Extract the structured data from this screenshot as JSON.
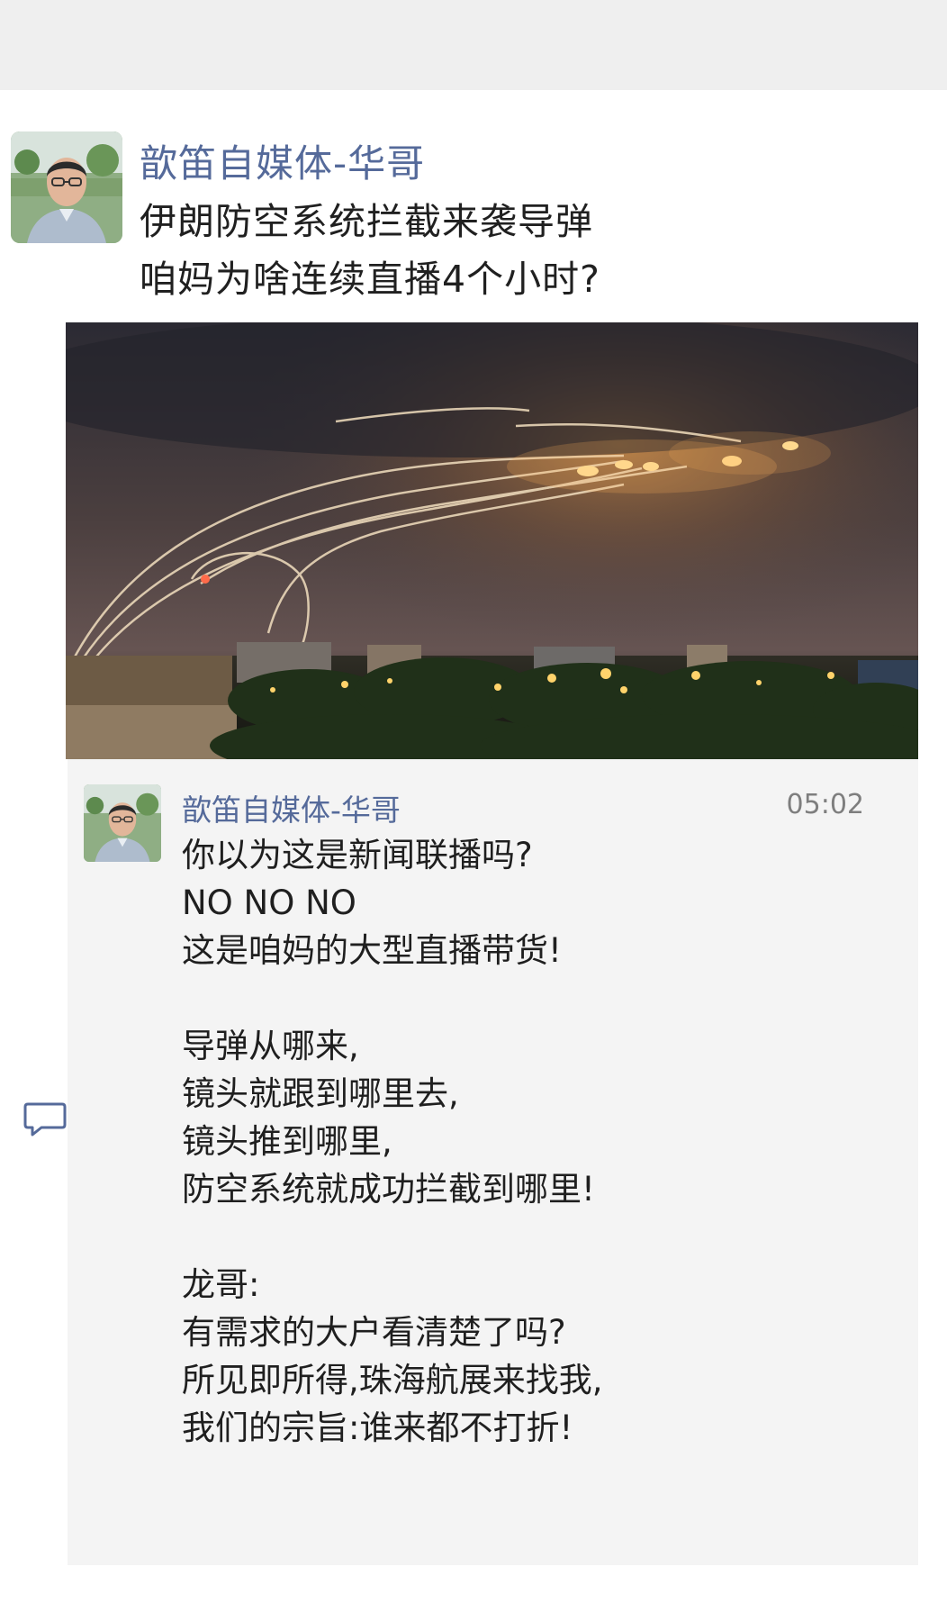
{
  "post": {
    "author": "歆笛自媒体-华哥",
    "text": "伊朗防空系统拦截来袭导弹\n咱妈为啥连续直播4个小时?"
  },
  "comment": {
    "author": "歆笛自媒体-华哥",
    "time": "05:02",
    "text": "你以为这是新闻联播吗?\nNO NO NO\n这是咱妈的大型直播带货!\n\n导弹从哪来,\n镜头就跟到哪里去,\n镜头推到哪里,\n防空系统就成功拦截到哪里!\n\n龙哥:\n有需求的大户看清楚了吗?\n所见即所得,珠海航展来找我,\n我们的宗旨:谁来都不打折!"
  },
  "icons": {
    "reply": "comment-bubble-icon"
  },
  "colors": {
    "author_name": "#556a9a",
    "comment_background": "#f4f4f4",
    "top_bar": "#efefef"
  }
}
